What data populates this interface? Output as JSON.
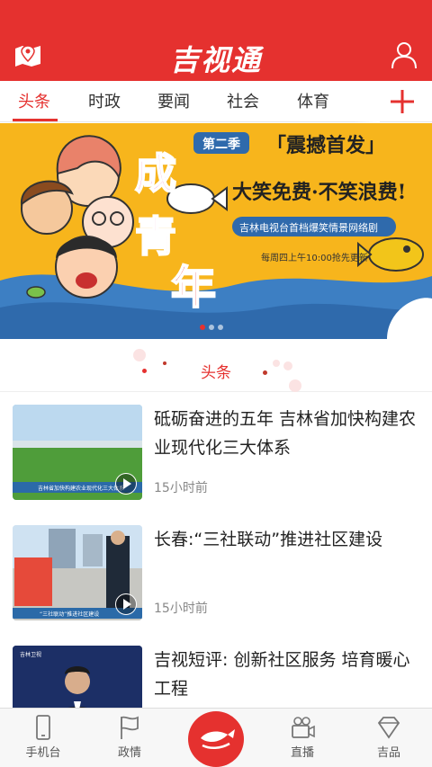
{
  "header": {
    "logo_text": "吉视通",
    "left_icon": "map-pin-icon",
    "right_icon": "user-icon"
  },
  "tabs": [
    {
      "label": "头条",
      "active": true
    },
    {
      "label": "时政",
      "active": false
    },
    {
      "label": "要闻",
      "active": false
    },
    {
      "label": "社会",
      "active": false
    },
    {
      "label": "体育",
      "active": false
    }
  ],
  "add_tab_icon": "plus-icon",
  "banner": {
    "season_badge": "第二季",
    "headline_bracket": "「震撼首发」",
    "title_chars": [
      "成",
      "鱼",
      "青",
      "年"
    ],
    "slogan": "大笑免费·不笑浪费!",
    "subline": "吉林电视台首档爆笑情景网络剧",
    "schedule": "每周四上午10:00抢先更新",
    "slides": 3,
    "active_slide": 0
  },
  "section": {
    "title": "头条"
  },
  "news": [
    {
      "title": "砥砺奋进的五年 吉林省加快构建农业现代化三大体系",
      "time": "15小时前",
      "has_video": true,
      "thumb_caption": "吉林省加快构建农业现代化三大体系"
    },
    {
      "title": "长春:“三社联动”推进社区建设",
      "time": "15小时前",
      "has_video": true,
      "thumb_caption": "“三社联动”推进社区建设"
    },
    {
      "title": "吉视短评: 创新社区服务 培育暖心工程",
      "time": "",
      "has_video": false,
      "thumb_caption": "吉林卫视"
    }
  ],
  "bottom_nav": [
    {
      "label": "手机台",
      "icon": "phone-icon"
    },
    {
      "label": "政情",
      "icon": "flag-icon"
    },
    {
      "label": "",
      "icon": "fish-logo-icon"
    },
    {
      "label": "直播",
      "icon": "video-camera-icon"
    },
    {
      "label": "吉品",
      "icon": "diamond-icon"
    }
  ],
  "colors": {
    "brand_red": "#e5312f",
    "banner_yellow": "#f7b51c",
    "text_dark": "#222222",
    "text_muted": "#888888"
  }
}
